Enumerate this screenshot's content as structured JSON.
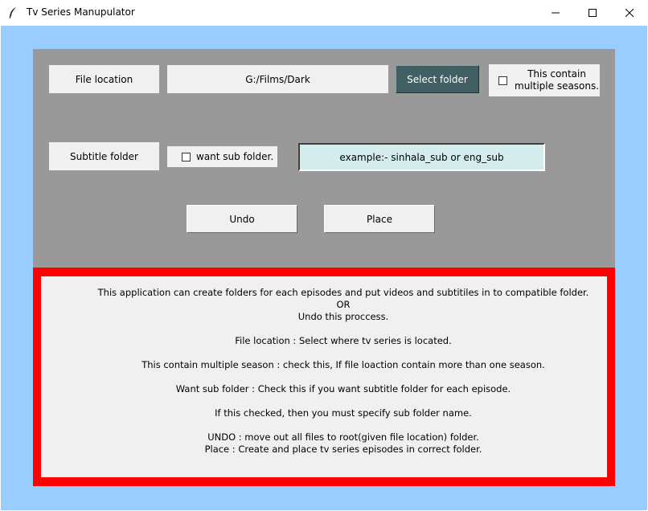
{
  "window": {
    "title": "Tv Series Manupulator"
  },
  "colors": {
    "client_background": "#99ccff",
    "panel_background": "#999999",
    "select_button_bg": "#3f5f62",
    "entry_bg": "#d4ecec",
    "info_border": "#ff0000"
  },
  "form": {
    "file_location_label": "File location",
    "file_location_value": "G:/Films/Dark",
    "select_folder_label": "Select folder",
    "multiple_seasons_label": "This contain\nmultiple seasons.",
    "multiple_seasons_checked": false,
    "subtitle_folder_label": "Subtitle folder",
    "want_sub_folder_label": "want sub folder.",
    "want_sub_folder_checked": false,
    "sub_folder_placeholder": "example:- sinhala_sub or eng_sub",
    "undo_label": "Undo",
    "place_label": "Place"
  },
  "info": {
    "lines": [
      "This application can create folders for each episodes and put videos and subtitiles in to compatible folder.",
      "OR",
      "Undo this proccess.",
      "",
      "File location : Select where tv series is located.",
      "",
      "This contain multiple season : check this, If file loaction contain more than one season.",
      "",
      "Want sub folder : Check this if you want subtitle folder for each episode.",
      "",
      "If this checked, then you must specify sub folder name.",
      "",
      "UNDO : move out all files to root(given file location) folder.",
      "Place : Create and place tv series episodes in correct folder."
    ]
  }
}
